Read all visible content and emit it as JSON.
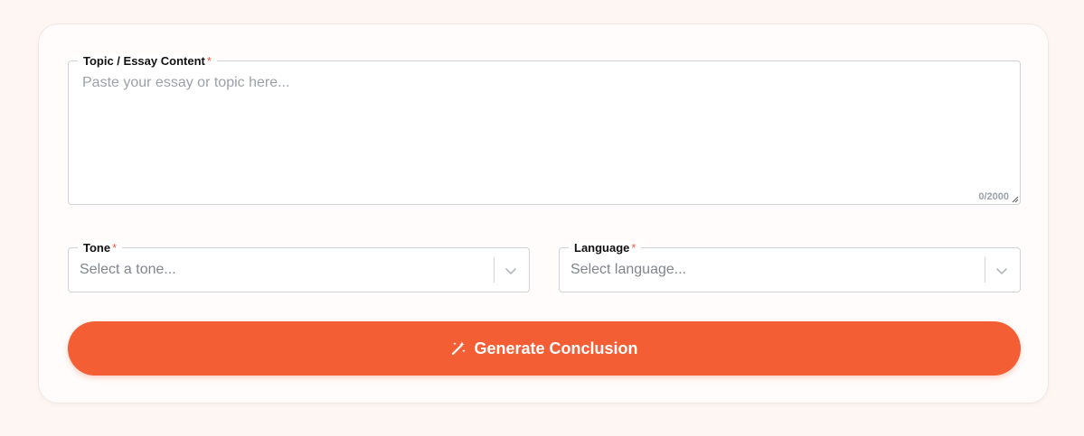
{
  "form": {
    "topic": {
      "label": "Topic / Essay Content",
      "required_mark": "*",
      "placeholder": "Paste your essay or topic here...",
      "value": "",
      "counter": "0/2000"
    },
    "tone": {
      "label": "Tone",
      "required_mark": "*",
      "placeholder": "Select a tone..."
    },
    "language": {
      "label": "Language",
      "required_mark": "*",
      "placeholder": "Select language..."
    },
    "generate_button": {
      "label": "Generate Conclusion",
      "icon": "magic-wand-icon"
    }
  },
  "colors": {
    "accent": "#f45e35",
    "page_background": "#fef6f3",
    "required": "#f05a33",
    "placeholder": "#9aa1a9"
  }
}
